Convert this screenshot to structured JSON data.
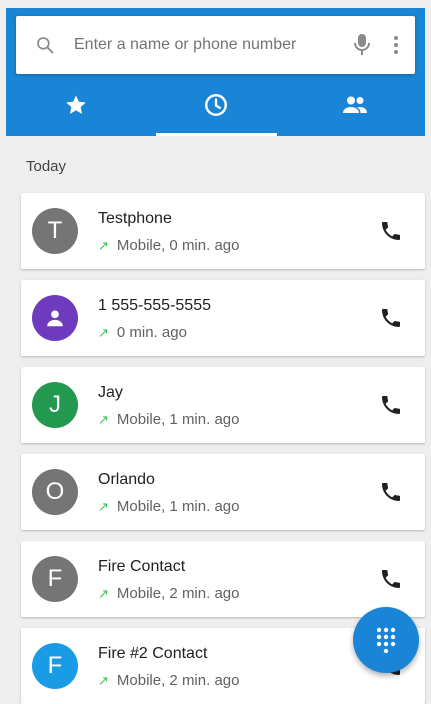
{
  "search": {
    "placeholder": "Enter a name or phone number"
  },
  "tabs": [
    {
      "name": "speed-dial",
      "icon": "star-icon",
      "active": false
    },
    {
      "name": "recents",
      "icon": "clock-icon",
      "active": true
    },
    {
      "name": "contacts",
      "icon": "people-icon",
      "active": false
    }
  ],
  "section": {
    "title": "Today"
  },
  "calls": [
    {
      "initial": "T",
      "avatar_color": "#757575",
      "name": "Testphone",
      "detail": "Mobile, 0 min. ago",
      "direction": "outgoing"
    },
    {
      "initial": "",
      "avatar_icon": "person-icon",
      "avatar_color": "#6e3bbf",
      "name": "1 555-555-5555",
      "detail": "0 min. ago",
      "direction": "outgoing"
    },
    {
      "initial": "J",
      "avatar_color": "#22994f",
      "name": "Jay",
      "detail": "Mobile, 1 min. ago",
      "direction": "outgoing"
    },
    {
      "initial": "O",
      "avatar_color": "#757575",
      "name": "Orlando",
      "detail": "Mobile, 1 min. ago",
      "direction": "outgoing"
    },
    {
      "initial": "F",
      "avatar_color": "#757575",
      "name": "Fire Contact",
      "detail": "Mobile, 2 min. ago",
      "direction": "outgoing"
    },
    {
      "initial": "F",
      "avatar_color": "#1a9be6",
      "name": "Fire #2 Contact",
      "detail": "Mobile, 2 min. ago",
      "direction": "outgoing"
    }
  ],
  "colors": {
    "primary": "#1a85d6",
    "outgoing_arrow": "#3fbf5a",
    "background": "#eeeeee"
  },
  "fab": {
    "icon": "dialpad-icon"
  }
}
